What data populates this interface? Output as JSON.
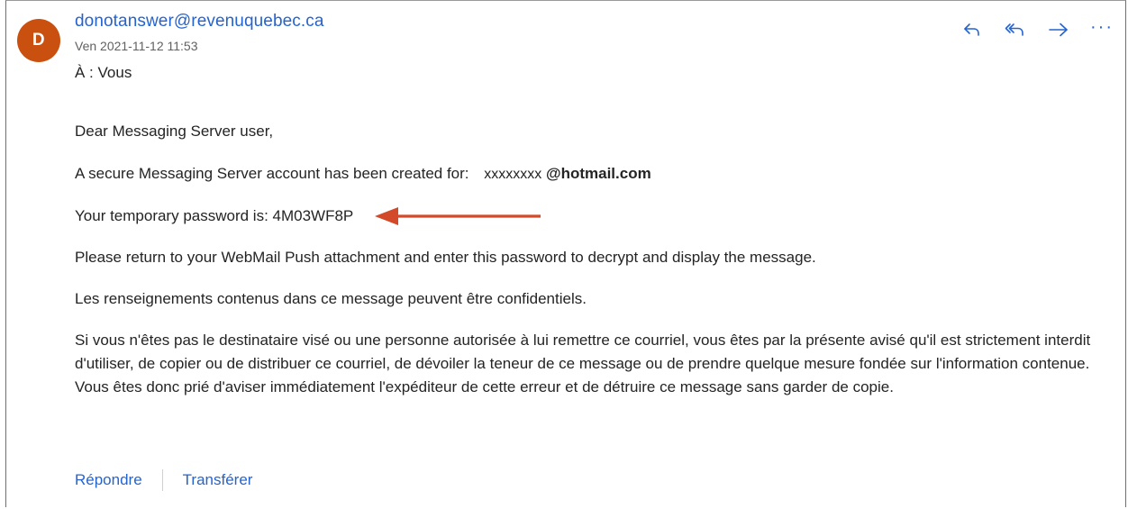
{
  "message": {
    "avatar_initial": "D",
    "sender": "donotanswer@revenuquebec.ca",
    "date": "Ven 2021-11-12 11:53",
    "to_label": "À : Vous"
  },
  "actions": {
    "reply_icon": "reply-icon",
    "reply_all_icon": "reply-all-icon",
    "forward_icon": "forward-icon",
    "more_label": "···"
  },
  "body": {
    "greeting": "Dear Messaging Server user,",
    "account_line_prefix": "A secure Messaging Server account has been created for:",
    "account_email_placeholder": "xxxxxxxx",
    "account_email_domain": "@hotmail.com",
    "password_line": "Your temporary password is: 4M03WF8P",
    "instructions": "Please return to your WebMail Push attachment and enter this password to decrypt and display the message.",
    "confidential": "Les renseignements contenus dans ce message peuvent être confidentiels.",
    "disclaimer": "Si vous n'êtes pas le destinataire visé ou une personne autorisée à lui remettre ce courriel, vous êtes par la présente avisé qu'il est strictement interdit d'utiliser, de copier ou de distribuer ce courriel, de dévoiler la teneur de ce message ou de prendre quelque mesure fondée sur l'information contenue. Vous êtes donc prié d'aviser immédiatement l'expéditeur de cette erreur et de détruire ce message sans garder de copie."
  },
  "footer": {
    "reply_label": "Répondre",
    "forward_label": "Transférer"
  },
  "colors": {
    "avatar_bg": "#ca5010",
    "link_blue": "#2564cf",
    "annotation_arrow": "#d24a2a"
  }
}
